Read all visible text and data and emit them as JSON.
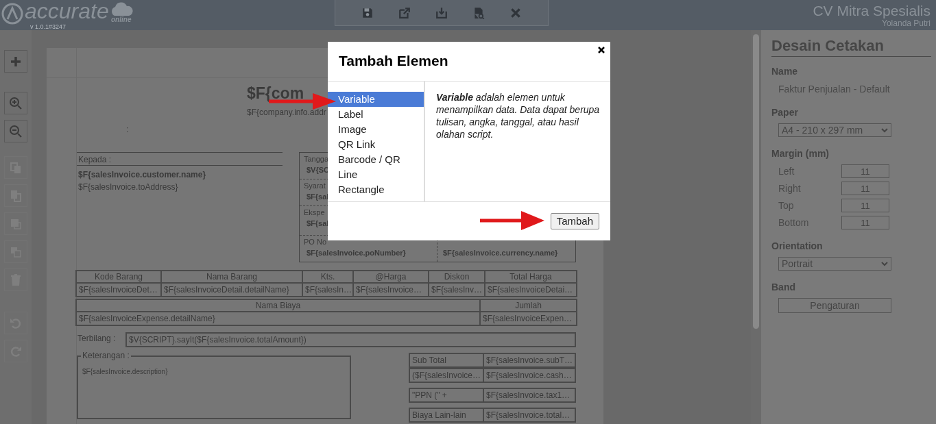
{
  "app": {
    "logo": "accurate",
    "logo_sub": "online",
    "version": "v 1.0.1#3247",
    "company": "CV Mitra Spesialis",
    "user": "Yolanda Putri"
  },
  "toolbar": [
    {
      "kind": "save"
    },
    {
      "kind": "export"
    },
    {
      "kind": "import"
    },
    {
      "kind": "preview"
    },
    {
      "kind": "close"
    }
  ],
  "left_tools": [
    {
      "kind": "add",
      "disabled": false
    },
    {
      "kind": "zoom_in",
      "disabled": false
    },
    {
      "kind": "zoom_out",
      "disabled": false
    },
    {
      "kind": "copy",
      "disabled": true
    },
    {
      "kind": "paste",
      "disabled": true
    },
    {
      "kind": "front",
      "disabled": true
    },
    {
      "kind": "back",
      "disabled": true
    },
    {
      "kind": "delete",
      "disabled": true
    },
    {
      "kind": "undo",
      "disabled": true
    },
    {
      "kind": "redo",
      "disabled": true
    }
  ],
  "report": {
    "title": "$F{com",
    "address": "$F{company.info.addr",
    "colon": ":",
    "to_label": "Kepada :",
    "customer_name": "$F{salesInvoice.customer.name}",
    "to_address": "$F{salesInvoice.toAddress}",
    "info_box": [
      {
        "label": "Tangga",
        "value": "$V{SC"
      },
      {
        "label": "Syarat",
        "value": "$F{sal"
      },
      {
        "label": "Ekspe",
        "value": "$F{sal"
      },
      {
        "label": "PO No",
        "value": "$F{salesInvoice.poNumber}"
      }
    ],
    "currency_value": "$F{salesInvoice.currency.name}",
    "items_table": {
      "columns": [
        "Kode Barang",
        "Nama Barang",
        "Kts.",
        "@Harga",
        "Diskon",
        "Total Harga"
      ],
      "rows": [
        [
          "$F{salesInvoiceDet…",
          "$F{salesInvoiceDetail.detailName}",
          "$F{salesIn…",
          "$F{salesInvoice…",
          "$F{salesInv…",
          "$F{salesInvoiceDetai…"
        ]
      ]
    },
    "expense_table": {
      "columns": [
        "Nama Biaya",
        "Jumlah"
      ],
      "rows": [
        [
          "$F{salesInvoiceExpense.detailName}",
          "$F{salesInvoiceExpen…"
        ]
      ]
    },
    "terbilang_label": "Terbilang :",
    "terbilang_value": "$V{SCRIPT}.sayIt($F{salesInvoice.totalAmount})",
    "notes_label": "Keterangan :",
    "notes_value": "$F{salesInvoice.description}",
    "totals": [
      [
        "Sub Total",
        "$F{salesInvoice.subT…"
      ],
      [
        "($F{salesInvoice…",
        "$F{salesInvoice.cash…"
      ],
      [
        "\"PPN (\" +",
        "$F{salesInvoice.tax1…"
      ],
      [
        "Biaya Lain-lain",
        "$F{salesInvoice.total…"
      ]
    ]
  },
  "modal": {
    "title": "Tambah Elemen",
    "items": [
      {
        "label": "Variable",
        "selected": true
      },
      {
        "label": "Label",
        "selected": false
      },
      {
        "label": "Image",
        "selected": false
      },
      {
        "label": "QR Link",
        "selected": false
      },
      {
        "label": "Barcode / QR",
        "selected": false
      },
      {
        "label": "Line",
        "selected": false
      },
      {
        "label": "Rectangle",
        "selected": false
      }
    ],
    "description": "**Variable** adalah elemen untuk menampilkan data. Data dapat berupa tulisan, angka, tanggal, atau hasil olahan script.",
    "button": "Tambah"
  },
  "panel": {
    "title": "Desain Cetakan",
    "name_label": "Name",
    "name_value": "Faktur Penjualan - Default",
    "paper_label": "Paper",
    "paper_value": "A4 - 210 x 297 mm",
    "margin_label": "Margin (mm)",
    "margins": [
      {
        "label": "Left",
        "value": "11"
      },
      {
        "label": "Right",
        "value": "11"
      },
      {
        "label": "Top",
        "value": "11"
      },
      {
        "label": "Bottom",
        "value": "11"
      }
    ],
    "orientation_label": "Orientation",
    "orientation_value": "Portrait",
    "band_label": "Band",
    "band_button": "Pengaturan"
  }
}
